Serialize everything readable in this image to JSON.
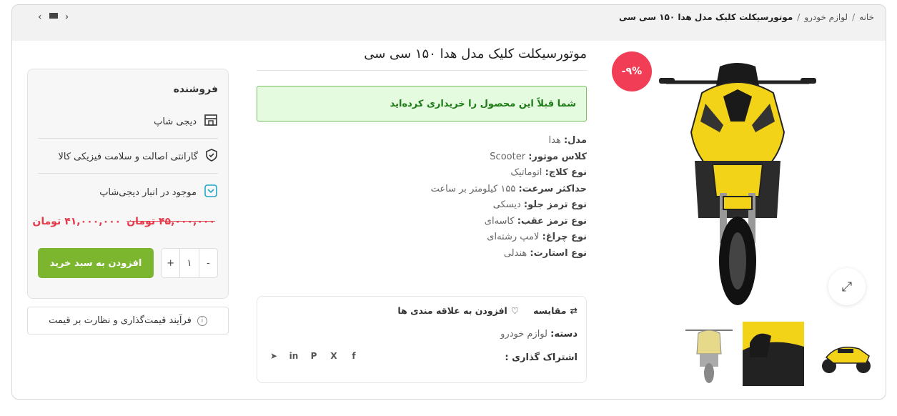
{
  "breadcrumb": {
    "home": "خانه",
    "category": "لوازم خودرو",
    "current": "موتورسیکلت کلیک مدل هدا ۱۵۰ سی سی",
    "separator": "/"
  },
  "product": {
    "title": "موتورسیکلت کلیک مدل هدا ۱۵۰ سی سی",
    "discount_badge": "-۹%",
    "purchased_notice": "شما قبلاً این محصول را خریداری کرده‌اید",
    "specs": [
      {
        "label": "مدل:",
        "value": "هدا"
      },
      {
        "label": "کلاس موتور:",
        "value": "Scooter"
      },
      {
        "label": "نوع کلاچ:",
        "value": "اتوماتیک"
      },
      {
        "label": "حداکثر سرعت:",
        "value": "۱۵۵ کیلومتر بر ساعت"
      },
      {
        "label": "نوع ترمز جلو:",
        "value": "دیسکی"
      },
      {
        "label": "نوع ترمز عقب:",
        "value": "کاسه‌ای"
      },
      {
        "label": "نوع چراغ:",
        "value": "لامپ رشته‌ای"
      },
      {
        "label": "نوع استارت:",
        "value": "هندلی"
      }
    ],
    "compare_label": "مقایسه",
    "wishlist_label": "افزودن به علاقه مندی ها",
    "category_label": "دسته:",
    "category_value": "لوازم خودرو",
    "share_label": "اشتراک گذاری :",
    "socials": [
      "facebook-icon",
      "x-icon",
      "pinterest-icon",
      "linkedin-icon",
      "telegram-icon"
    ],
    "accent_color": "#f23d57",
    "body_color": "#f3d318"
  },
  "seller": {
    "heading": "فروشنده",
    "shop_name": "دیجی شاپ",
    "guarantee": "گارانتی اصالت و سلامت فیزیکی کالا",
    "stock": "موجود در انبار دیجی‌شاپ",
    "old_price": "۴۵,۰۰۰,۰۰۰ تومان",
    "new_price": "۴۱,۰۰۰,۰۰۰ تومان",
    "quantity": "۱",
    "qty_plus": "+",
    "qty_minus": "-",
    "add_to_cart": "افزودن به سبد خرید",
    "button_color": "#7cb52e"
  },
  "price_process": "فرآیند قیمت‌گذاری و نظارت بر قیمت",
  "social_glyphs": {
    "facebook": "f",
    "x": "X",
    "pinterest": "P",
    "linkedin": "in",
    "telegram": "➤"
  }
}
